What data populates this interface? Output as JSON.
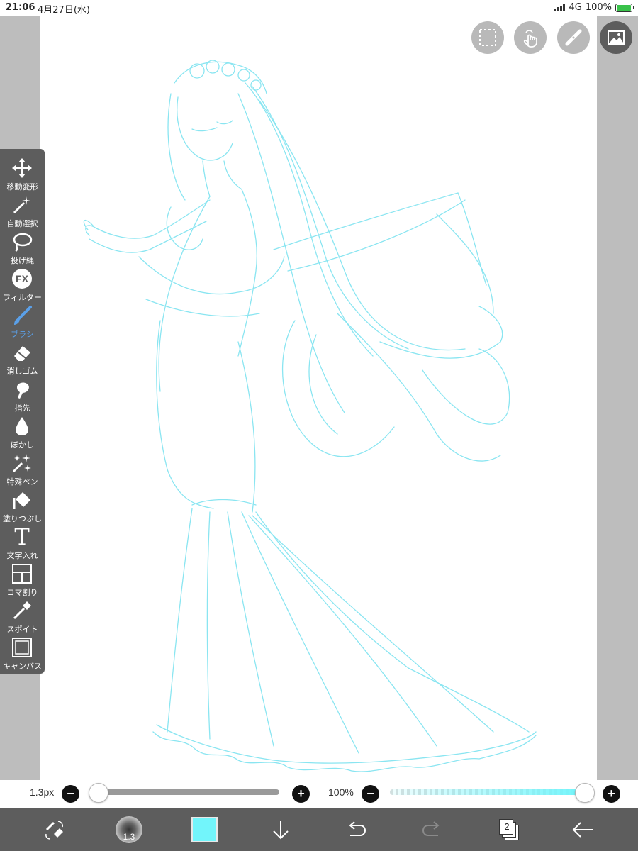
{
  "status_bar": {
    "time": "21:06",
    "date": "4月27日(水)",
    "network": "4G",
    "battery": "100%",
    "battery_color": "#39c24a"
  },
  "top_buttons": [
    {
      "name": "selection-rectangle-icon"
    },
    {
      "name": "gesture-hand-icon"
    },
    {
      "name": "ruler-icon"
    },
    {
      "name": "material-image-icon"
    }
  ],
  "tools": [
    {
      "id": "move",
      "label": "移動変形",
      "icon": "move-icon"
    },
    {
      "id": "magic-wand",
      "label": "自動選択",
      "icon": "magic-wand-icon"
    },
    {
      "id": "lasso",
      "label": "投げ縄",
      "icon": "lasso-icon"
    },
    {
      "id": "filter",
      "label": "フィルター",
      "icon_text": "FX",
      "icon": "filter-fx-icon"
    },
    {
      "id": "brush",
      "label": "ブラシ",
      "icon": "brush-icon",
      "active": true
    },
    {
      "id": "eraser",
      "label": "消しゴム",
      "icon": "eraser-icon"
    },
    {
      "id": "finger",
      "label": "指先",
      "icon": "smudge-finger-icon"
    },
    {
      "id": "blur",
      "label": "ぼかし",
      "icon": "blur-drop-icon"
    },
    {
      "id": "special-pen",
      "label": "特殊ペン",
      "icon": "sparkle-pen-icon"
    },
    {
      "id": "fill",
      "label": "塗りつぶし",
      "icon": "bucket-fill-icon"
    },
    {
      "id": "text",
      "label": "文字入れ",
      "icon_text": "T",
      "icon": "text-icon"
    },
    {
      "id": "frame",
      "label": "コマ割り",
      "icon": "frame-divider-icon"
    },
    {
      "id": "eyedropper",
      "label": "スポイト",
      "icon": "eyedropper-icon"
    },
    {
      "id": "canvas",
      "label": "キャンバス",
      "icon": "canvas-icon"
    }
  ],
  "brush_size_slider": {
    "value_label": "1.3px",
    "level": 0.0
  },
  "opacity_slider": {
    "value_label": "100%",
    "level": 1.0
  },
  "bottom_bar": {
    "brush_size_label": "1.3",
    "current_color": "#72f5fb",
    "layer_count": "2"
  },
  "colors": {
    "accent_active": "#5ba0e8",
    "sketch_line": "#7ee3f0",
    "panel_bg": "#5d5d5d"
  }
}
